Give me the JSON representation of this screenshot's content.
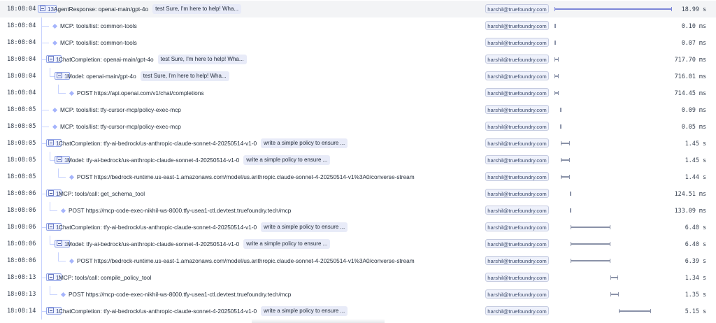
{
  "accent_color": "#7c86d8",
  "spans": [
    {
      "ts": "18:08:04",
      "depth": 0,
      "badge": "13",
      "label": "AgentResponse: openai-main/gpt-4o",
      "chip": "test Sure, I'm here to help! Wha...",
      "user": "harshil@truefoundry.com",
      "duration": "18.99 s",
      "start": 0.0,
      "dur": 18.99
    },
    {
      "ts": "18:08:04",
      "depth": 1,
      "label": "MCP: tools/list: common-tools",
      "user": "harshil@truefoundry.com",
      "duration": "0.10 ms",
      "start": 0.0,
      "dur": 0.0001
    },
    {
      "ts": "18:08:04",
      "depth": 1,
      "label": "MCP: tools/list: common-tools",
      "user": "harshil@truefoundry.com",
      "duration": "0.07 ms",
      "start": 0.0,
      "dur": 7e-05
    },
    {
      "ts": "18:08:04",
      "depth": 1,
      "badge": "1",
      "label": "ChatCompletion: openai-main/gpt-4o",
      "chip": "test Sure, I'm here to help! Wha...",
      "user": "harshil@truefoundry.com",
      "duration": "717.70 ms",
      "start": 0.0,
      "dur": 0.7177
    },
    {
      "ts": "18:08:04",
      "depth": 2,
      "badge": "1",
      "label": "Model: openai-main/gpt-4o",
      "chip": "test Sure, I'm here to help! Wha...",
      "user": "harshil@truefoundry.com",
      "duration": "716.01 ms",
      "start": 0.0,
      "dur": 0.716
    },
    {
      "ts": "18:08:04",
      "depth": 3,
      "label": "POST https://api.openai.com/v1/chat/completions",
      "user": "harshil@truefoundry.com",
      "duration": "714.45 ms",
      "start": 0.0,
      "dur": 0.7145
    },
    {
      "ts": "18:08:05",
      "depth": 1,
      "label": "MCP: tools/list: tfy-cursor-mcp/policy-exec-mcp",
      "user": "harshil@truefoundry.com",
      "duration": "0.09 ms",
      "start": 0.9,
      "dur": 0.0001
    },
    {
      "ts": "18:08:05",
      "depth": 1,
      "label": "MCP: tools/list: tfy-cursor-mcp/policy-exec-mcp",
      "user": "harshil@truefoundry.com",
      "duration": "0.05 ms",
      "start": 0.9,
      "dur": 0.0001
    },
    {
      "ts": "18:08:05",
      "depth": 1,
      "badge": "1",
      "label": "ChatCompletion: tfy-ai-bedrock/us-anthropic-claude-sonnet-4-20250514-v1-0",
      "chip": "write a simple policy to ensure ...",
      "user": "harshil@truefoundry.com",
      "duration": "1.45 s",
      "start": 1.0,
      "dur": 1.45
    },
    {
      "ts": "18:08:05",
      "depth": 2,
      "badge": "1",
      "label": "Model: tfy-ai-bedrock/us-anthropic-claude-sonnet-4-20250514-v1-0",
      "chip": "write a simple policy to ensure ...",
      "user": "harshil@truefoundry.com",
      "duration": "1.45 s",
      "start": 1.0,
      "dur": 1.45
    },
    {
      "ts": "18:08:05",
      "depth": 3,
      "label": "POST https://bedrock-runtime.us-east-1.amazonaws.com/model/us.anthropic.claude-sonnet-4-20250514-v1%3A0/converse-stream",
      "user": "harshil@truefoundry.com",
      "duration": "1.44 s",
      "start": 1.0,
      "dur": 1.44
    },
    {
      "ts": "18:08:06",
      "depth": 1,
      "badge": "1",
      "label": "MCP: tools/call: get_schema_tool",
      "user": "harshil@truefoundry.com",
      "duration": "124.51 ms",
      "start": 2.45,
      "dur": 0.1245
    },
    {
      "ts": "18:08:06",
      "depth": 2,
      "label": "POST https://mcp-code-exec-nikhil-ws-8000.tfy-usea1-ctl.devtest.truefoundry.tech/mcp",
      "user": "harshil@truefoundry.com",
      "duration": "133.09 ms",
      "start": 2.45,
      "dur": 0.1331
    },
    {
      "ts": "18:08:06",
      "depth": 1,
      "badge": "1",
      "label": "ChatCompletion: tfy-ai-bedrock/us-anthropic-claude-sonnet-4-20250514-v1-0",
      "chip": "write a simple policy to ensure ...",
      "user": "harshil@truefoundry.com",
      "duration": "6.40 s",
      "start": 2.6,
      "dur": 6.4
    },
    {
      "ts": "18:08:06",
      "depth": 2,
      "badge": "1",
      "label": "Model: tfy-ai-bedrock/us-anthropic-claude-sonnet-4-20250514-v1-0",
      "chip": "write a simple policy to ensure ...",
      "user": "harshil@truefoundry.com",
      "duration": "6.40 s",
      "start": 2.6,
      "dur": 6.4
    },
    {
      "ts": "18:08:06",
      "depth": 3,
      "label": "POST https://bedrock-runtime.us-east-1.amazonaws.com/model/us.anthropic.claude-sonnet-4-20250514-v1%3A0/converse-stream",
      "user": "harshil@truefoundry.com",
      "duration": "6.39 s",
      "start": 2.6,
      "dur": 6.39
    },
    {
      "ts": "18:08:13",
      "depth": 1,
      "badge": "1",
      "label": "MCP: tools/call: compile_policy_tool",
      "user": "harshil@truefoundry.com",
      "duration": "1.34 s",
      "start": 9.0,
      "dur": 1.34
    },
    {
      "ts": "18:08:13",
      "depth": 2,
      "label": "POST https://mcp-code-exec-nikhil-ws-8000.tfy-usea1-ctl.devtest.truefoundry.tech/mcp",
      "user": "harshil@truefoundry.com",
      "duration": "1.35 s",
      "start": 9.0,
      "dur": 1.35
    },
    {
      "ts": "18:08:14",
      "depth": 1,
      "badge": "1",
      "label": "ChatCompletion: tfy-ai-bedrock/us-anthropic-claude-sonnet-4-20250514-v1-0",
      "chip": "write a simple policy to ensure ...",
      "user": "harshil@truefoundry.com",
      "duration": "5.15 s",
      "start": 10.4,
      "dur": 5.15
    }
  ]
}
